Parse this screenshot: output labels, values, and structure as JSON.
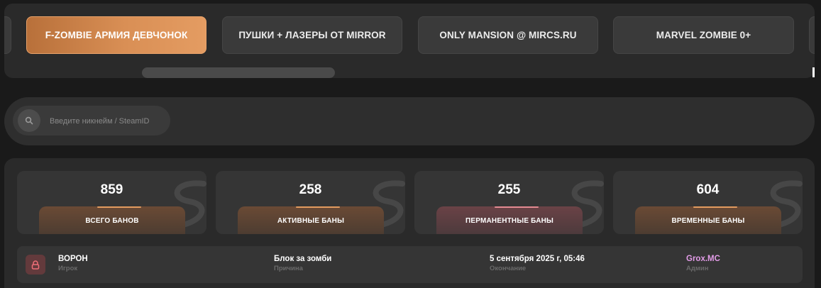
{
  "servers": {
    "tabs": [
      {
        "label": "F-ZOMBIE АРМИЯ ДЕВЧОНОК",
        "active": true
      },
      {
        "label": "ПУШКИ + ЛАЗЕРЫ ОТ MIRROR",
        "active": false
      },
      {
        "label": "ONLY MANSION @ MIRCS.RU",
        "active": false
      },
      {
        "label": "MARVEL ZOMBIE 0+",
        "active": false
      }
    ]
  },
  "search": {
    "placeholder": "Введите никнейм / SteamID",
    "icon": "search-icon"
  },
  "stats": [
    {
      "value": "859",
      "label": "ВСЕГО БАНОВ",
      "accent": "#e39b5f"
    },
    {
      "value": "258",
      "label": "АКТИВНЫЕ БАНЫ",
      "accent": "#e39b5f"
    },
    {
      "value": "255",
      "label": "ПЕРМАНЕНТНЫЕ БАНЫ",
      "accent": "#e48a92"
    },
    {
      "value": "604",
      "label": "ВРЕМЕННЫЕ БАНЫ",
      "accent": "#e39b5f"
    }
  ],
  "bans": [
    {
      "icon": "lock-icon",
      "player": {
        "value": "ВОРОН",
        "label": "Игрок"
      },
      "reason": {
        "value": "Блок за зомби",
        "label": "Причина"
      },
      "expires": {
        "value": "5 сентября 2025 г, 05:46",
        "label": "Окончание"
      },
      "admin": {
        "value": "Grox.MC",
        "label": "Админ",
        "color": "#e39ce8"
      }
    }
  ]
}
